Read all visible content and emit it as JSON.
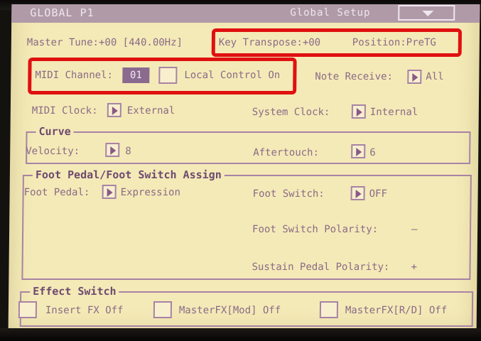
{
  "header": {
    "page_title": "GLOBAL  P1",
    "tab_label": "Global Setup"
  },
  "row1": {
    "master_tune": "Master Tune:+00 [440.00Hz]",
    "key_transpose": "Key Transpose:+00",
    "position": "Position:PreTG"
  },
  "row2": {
    "midi_channel_label": "MIDI Channel:",
    "midi_channel_value": "01",
    "local_control_label": "Local Control On",
    "note_receive_label": "Note Receive:",
    "note_receive_value": "All"
  },
  "row3": {
    "midi_clock_label": "MIDI Clock:",
    "midi_clock_value": "External",
    "system_clock_label": "System Clock:",
    "system_clock_value": "Internal"
  },
  "curve": {
    "title": "Curve",
    "velocity_label": "Velocity:",
    "velocity_value": "8",
    "aftertouch_label": "Aftertouch:",
    "aftertouch_value": "6"
  },
  "foot": {
    "title": "Foot Pedal/Foot Switch Assign",
    "foot_pedal_label": "Foot Pedal:",
    "foot_pedal_value": "Expression",
    "foot_switch_label": "Foot Switch:",
    "foot_switch_value": "OFF",
    "foot_switch_polarity": "Foot Switch Polarity:",
    "foot_switch_polarity_value": "–",
    "sustain_polarity": "Sustain Pedal Polarity:",
    "sustain_polarity_value": "+"
  },
  "effect": {
    "title": "Effect Switch",
    "insert_fx": "Insert FX Off",
    "master_mod": "MasterFX[Mod] Off",
    "master_rd": "MasterFX[R/D] Off"
  },
  "colors": {
    "screen_bg": "#f4eab7",
    "text": "#8a6a86",
    "title_bar": "#b09aa8",
    "highlight_box": "#e01010"
  }
}
